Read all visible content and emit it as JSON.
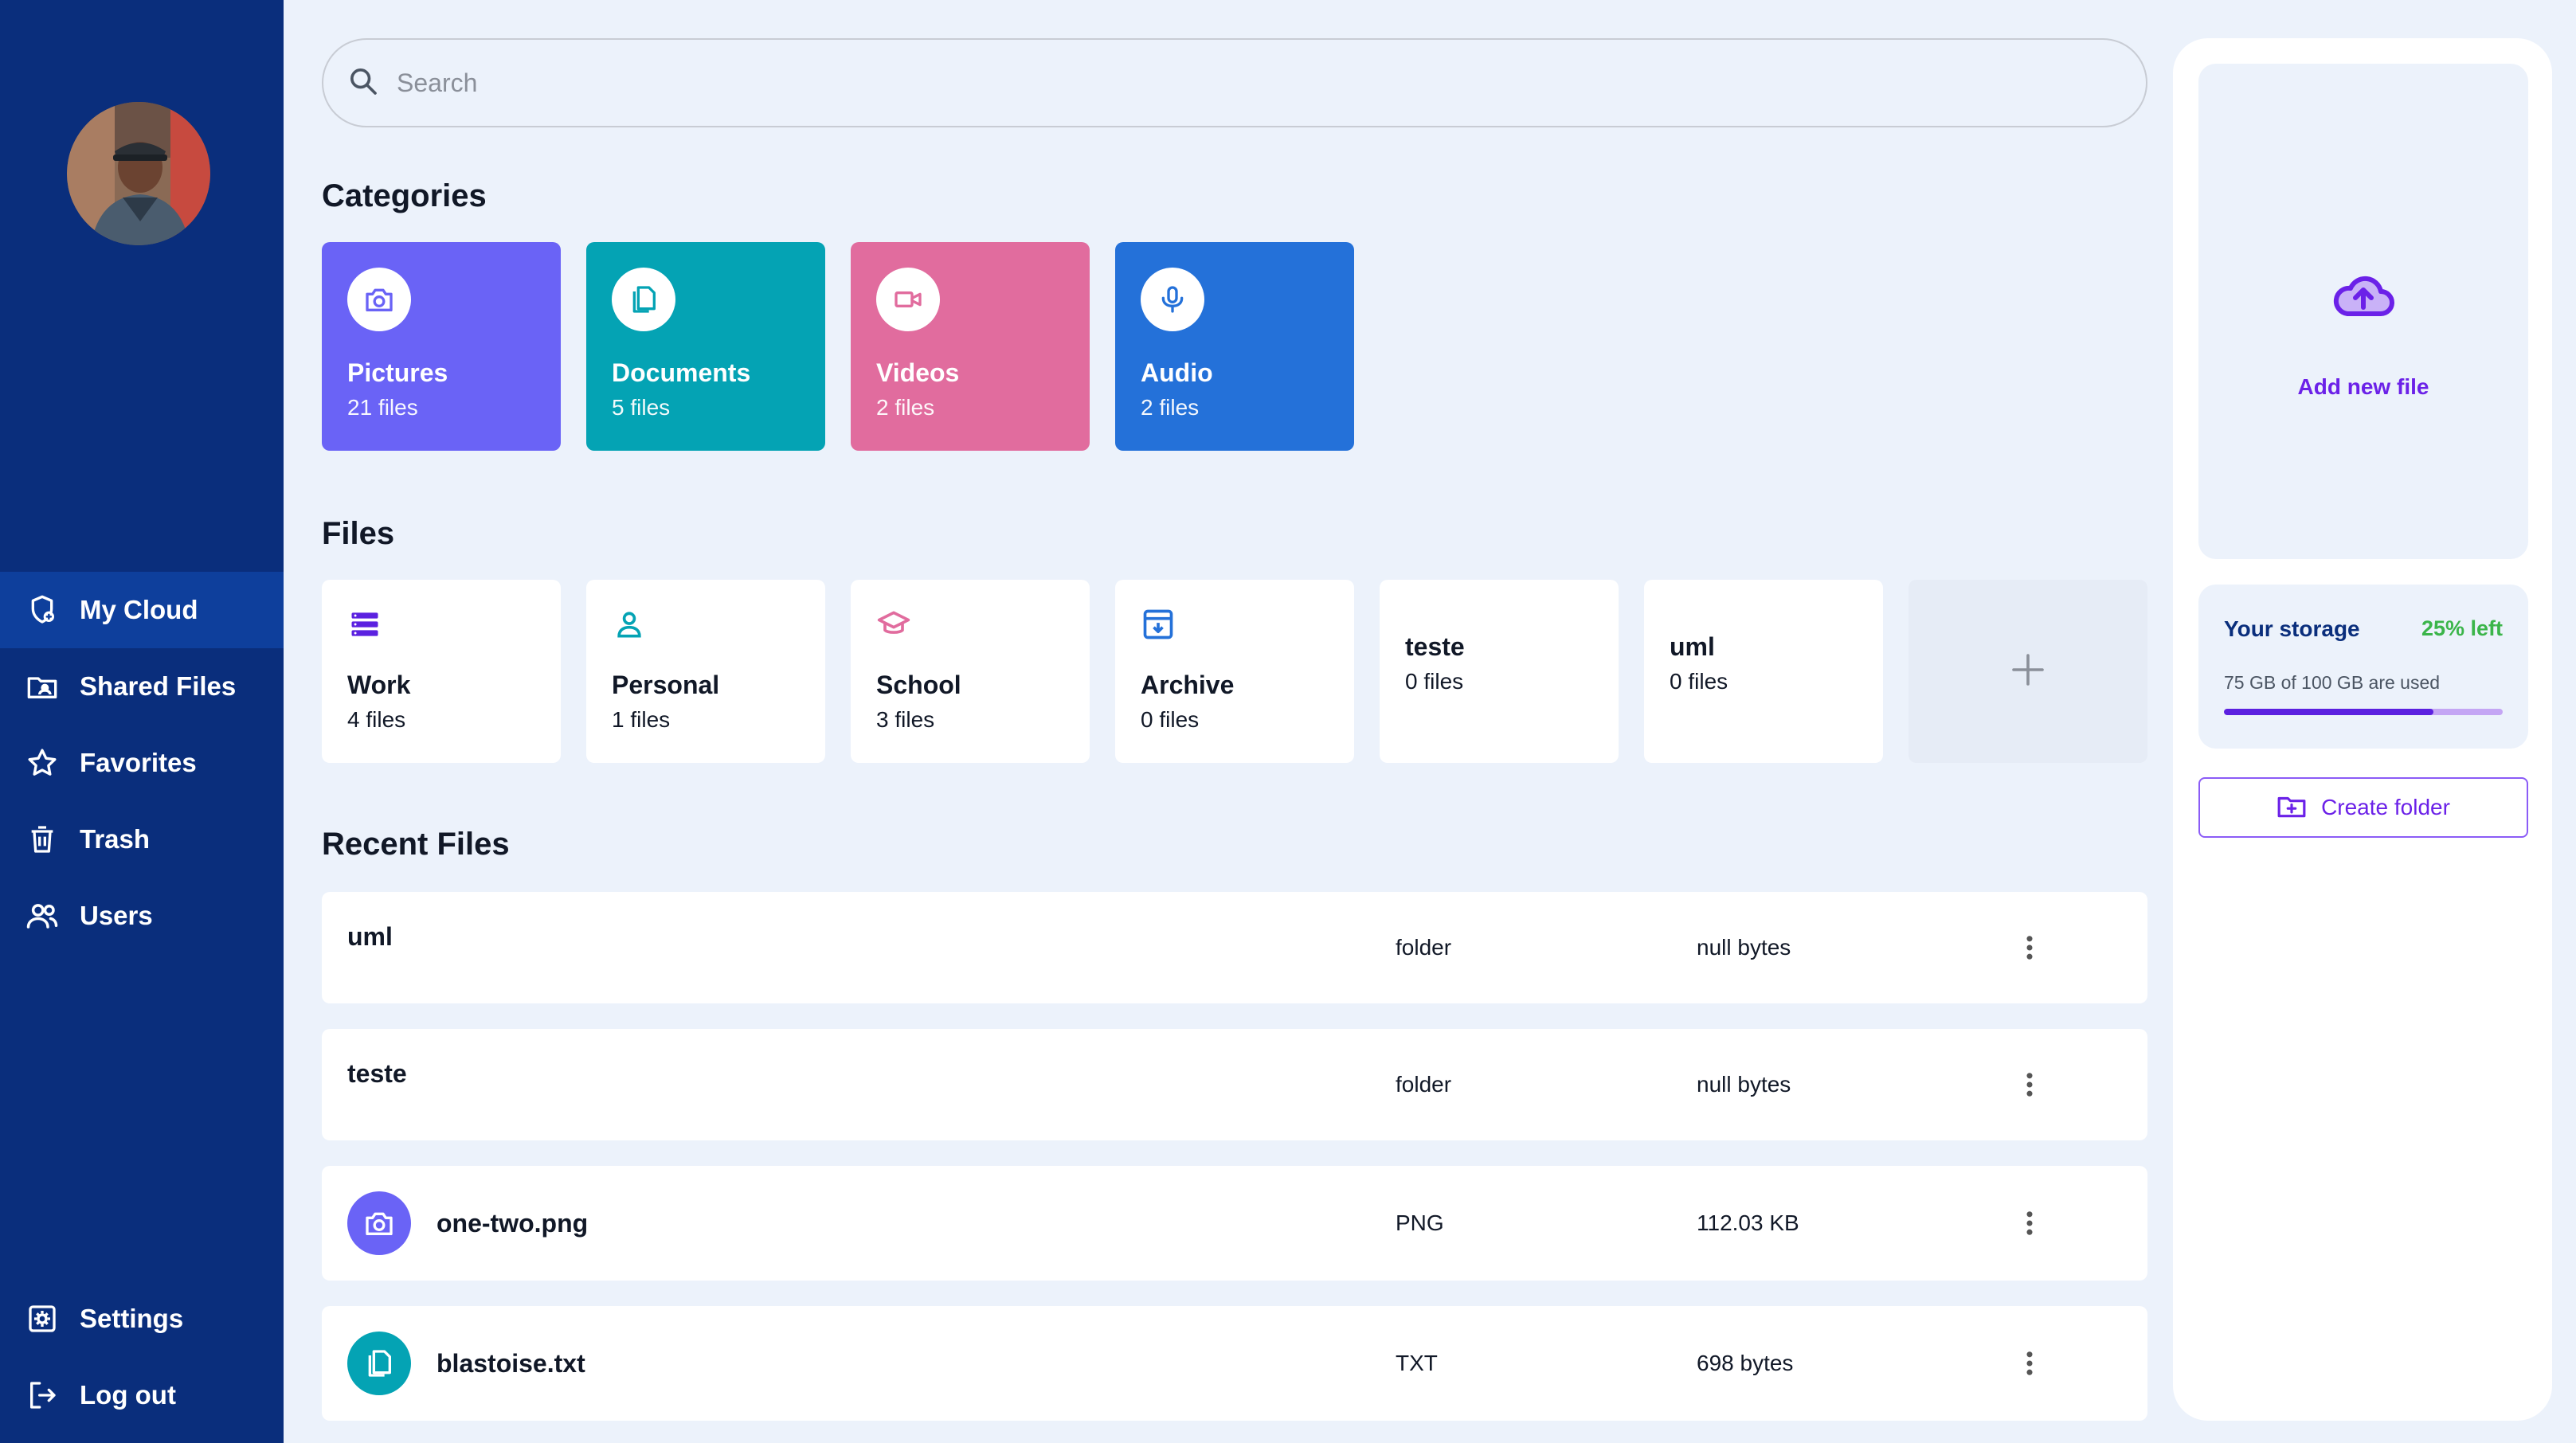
{
  "colors": {
    "sidebar_bg": "#0a2e7c",
    "sidebar_active": "#0e3f9c",
    "page_bg": "#ecf2fb",
    "accent_purple": "#6b21e8",
    "storage_green": "#3bb54a",
    "pictures": "#6a63f6",
    "documents": "#04a3b4",
    "videos": "#e16c9e",
    "audio": "#2471d9"
  },
  "sidebar": {
    "avatar_icon": "user-avatar",
    "nav": [
      {
        "label": "My Cloud",
        "icon": "cloud-shield-icon",
        "active": true
      },
      {
        "label": "Shared Files",
        "icon": "shared-folder-icon"
      },
      {
        "label": "Favorites",
        "icon": "star-icon"
      },
      {
        "label": "Trash",
        "icon": "trash-icon"
      },
      {
        "label": "Users",
        "icon": "users-icon"
      }
    ],
    "bottom": [
      {
        "label": "Settings",
        "icon": "settings-icon"
      },
      {
        "label": "Log out",
        "icon": "logout-icon"
      }
    ]
  },
  "search": {
    "placeholder": "Search",
    "value": ""
  },
  "categories": {
    "title": "Categories",
    "items": [
      {
        "name": "Pictures",
        "count": "21 files",
        "icon": "camera-icon"
      },
      {
        "name": "Documents",
        "count": "5 files",
        "icon": "documents-icon"
      },
      {
        "name": "Videos",
        "count": "2 files",
        "icon": "video-camera-icon"
      },
      {
        "name": "Audio",
        "count": "2 files",
        "icon": "microphone-icon"
      }
    ]
  },
  "files": {
    "title": "Files",
    "items": [
      {
        "name": "Work",
        "count": "4 files",
        "icon": "stack-icon"
      },
      {
        "name": "Personal",
        "count": "1 files",
        "icon": "person-icon"
      },
      {
        "name": "School",
        "count": "3 files",
        "icon": "graduation-cap-icon"
      },
      {
        "name": "Archive",
        "count": "0 files",
        "icon": "archive-icon"
      },
      {
        "name": "teste",
        "count": "0 files"
      },
      {
        "name": "uml",
        "count": "0 files"
      }
    ],
    "add_icon": "plus-icon"
  },
  "recent": {
    "title": "Recent Files",
    "rows": [
      {
        "name": "uml",
        "type": "folder",
        "size": "null bytes"
      },
      {
        "name": "teste",
        "type": "folder",
        "size": "null bytes"
      },
      {
        "name": "one-two.png",
        "type": "PNG",
        "size": "112.03 KB",
        "icon": "camera-icon"
      },
      {
        "name": "blastoise.txt",
        "type": "TXT",
        "size": "698 bytes",
        "icon": "documents-icon"
      }
    ]
  },
  "right_panel": {
    "upload_label": "Add new file",
    "upload_icon": "cloud-upload-icon",
    "storage": {
      "title": "Your storage",
      "left": "25% left",
      "used_text": "75 GB of 100 GB are used",
      "used_fraction": 0.75
    },
    "create_folder_label": "Create folder",
    "create_folder_icon": "folder-plus-icon"
  }
}
